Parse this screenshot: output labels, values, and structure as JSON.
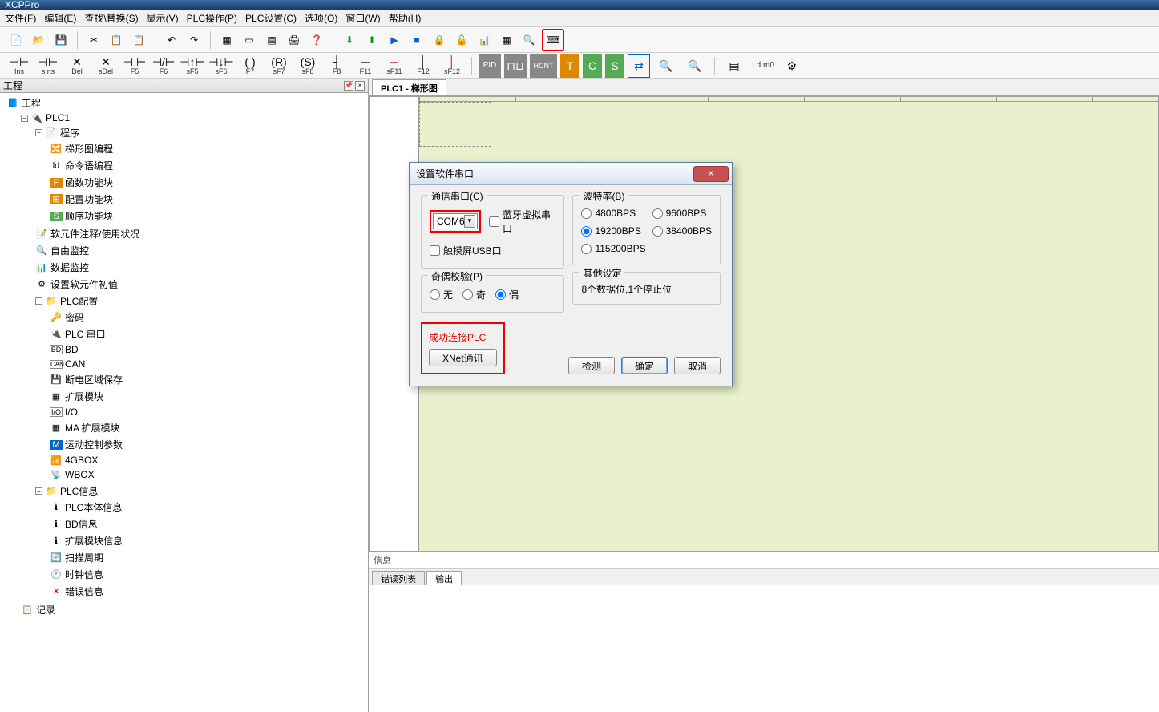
{
  "title": "XCPPro",
  "menu": [
    "文件(F)",
    "编辑(E)",
    "查找\\替换(S)",
    "显示(V)",
    "PLC操作(P)",
    "PLC设置(C)",
    "选项(O)",
    "窗口(W)",
    "帮助(H)"
  ],
  "toolbar1_icons": [
    "new",
    "open",
    "save",
    "cut",
    "copy",
    "paste",
    "undo",
    "redo",
    "grid",
    "box",
    "grid2",
    "print",
    "help-blue"
  ],
  "toolbar1_icons2": [
    "down-green",
    "up-green",
    "play-blue",
    "stop-blue",
    "lock",
    "unlock",
    "chart",
    "table",
    "zoom",
    "comm-red"
  ],
  "toolbar2": [
    {
      "ic": "⊣⊢",
      "lb": "Ins"
    },
    {
      "ic": "⊣⊢",
      "lb": "sIns"
    },
    {
      "ic": "⊣✕",
      "lb": "Del"
    },
    {
      "ic": "⊣✕",
      "lb": "sDel"
    },
    {
      "ic": "⊣ ⊢",
      "lb": "F5"
    },
    {
      "ic": "⊣/⊢",
      "lb": "F6"
    },
    {
      "ic": "⊣↑⊢",
      "lb": "sF5"
    },
    {
      "ic": "⊣↓⊢",
      "lb": "sF6"
    },
    {
      "ic": "( )",
      "lb": "F7"
    },
    {
      "ic": "(R)",
      "lb": "sF7"
    },
    {
      "ic": "(S)",
      "lb": "sF8"
    },
    {
      "ic": "┤",
      "lb": "F8"
    },
    {
      "ic": "─",
      "lb": "F11"
    },
    {
      "ic": "─",
      "lb": "sF11"
    },
    {
      "ic": "│",
      "lb": "F12"
    },
    {
      "ic": "│",
      "lb": "sF12"
    },
    {
      "ic": "PID",
      "lb": ""
    },
    {
      "ic": "⊓⊔",
      "lb": ""
    },
    {
      "ic": "HCNT",
      "lb": ""
    },
    {
      "ic": "T",
      "lb": ""
    },
    {
      "ic": "C",
      "lb": ""
    },
    {
      "ic": "S",
      "lb": ""
    },
    {
      "ic": "⇄",
      "lb": ""
    },
    {
      "ic": "🔍+",
      "lb": ""
    },
    {
      "ic": "🔍-",
      "lb": ""
    },
    {
      "ic": "▤",
      "lb": ""
    },
    {
      "ic": "Ld m0",
      "lb": ""
    },
    {
      "ic": "⚙",
      "lb": ""
    }
  ],
  "left_panel_title": "工程",
  "tree": {
    "root": "工程",
    "plc": "PLC1",
    "program": "程序",
    "program_items": [
      "梯形图编程",
      "命令语编程",
      "函数功能块",
      "配置功能块",
      "顺序功能块"
    ],
    "misc": [
      "软元件注释/使用状况",
      "自由监控",
      "数据监控",
      "设置软元件初值"
    ],
    "plc_config": "PLC配置",
    "plc_config_items": [
      "密码",
      "PLC 串口",
      "BD",
      "CAN",
      "断电区域保存",
      "扩展模块",
      "I/O",
      "MA 扩展模块",
      "运动控制参数",
      "4GBOX",
      "WBOX"
    ],
    "plc_info": "PLC信息",
    "plc_info_items": [
      "PLC本体信息",
      "BD信息",
      "扩展模块信息",
      "扫描周期",
      "时钟信息",
      "错误信息"
    ],
    "record": "记录"
  },
  "canvas_tab": "PLC1 - 梯形图",
  "msg_title": "信息",
  "msg_tabs": [
    "错误列表",
    "输出"
  ],
  "dialog": {
    "title": "设置软件串口",
    "grp_comm": "通信串口(C)",
    "com_value": "COM6",
    "cb_bt": "蓝牙虚拟串口",
    "cb_usb": "触摸屏USB口",
    "grp_baud": "波特率(B)",
    "bauds": [
      "4800BPS",
      "9600BPS",
      "19200BPS",
      "38400BPS",
      "115200BPS"
    ],
    "grp_parity": "奇偶校验(P)",
    "parity": [
      "无",
      "奇",
      "偶"
    ],
    "grp_other": "其他设定",
    "other_text": "8个数据位,1个停止位",
    "status": "成功连接PLC",
    "xnet": "XNet通讯",
    "btn_detect": "检测",
    "btn_ok": "确定",
    "btn_cancel": "取消"
  }
}
